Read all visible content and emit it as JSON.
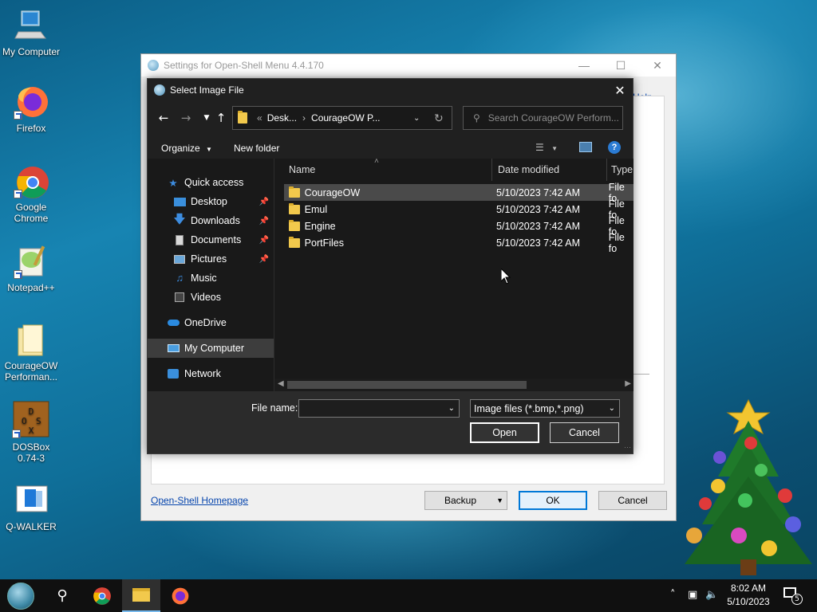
{
  "desktop": {
    "icons": [
      {
        "label": "My Computer"
      },
      {
        "label": "Firefox"
      },
      {
        "label": "Google Chrome"
      },
      {
        "label": "Notepad++"
      },
      {
        "label": "CourageOW Performan..."
      },
      {
        "label": "DOSBox 0.74-3"
      },
      {
        "label": "Q-WALKER"
      }
    ]
  },
  "settings_window": {
    "title": "Settings for Open-Shell Menu 4.4.170",
    "help_link": "Help...",
    "homepage_link": "Open-Shell Homepage",
    "backup_label": "Backup",
    "ok_label": "OK",
    "cancel_label": "Cancel"
  },
  "dialog": {
    "title": "Select Image File",
    "address": {
      "prefix": "«",
      "segment1": "Desk...",
      "segment2": "CourageOW P..."
    },
    "search_placeholder": "Search CourageOW Perform...",
    "organize_label": "Organize",
    "new_folder_label": "New folder",
    "nav_items": [
      {
        "label": "Quick access",
        "icon": "star-icon"
      },
      {
        "label": "Desktop",
        "icon": "desktop-icon",
        "pinned": true
      },
      {
        "label": "Downloads",
        "icon": "download-icon",
        "pinned": true
      },
      {
        "label": "Documents",
        "icon": "document-icon",
        "pinned": true
      },
      {
        "label": "Pictures",
        "icon": "pictures-icon",
        "pinned": true
      },
      {
        "label": "Music",
        "icon": "music-icon"
      },
      {
        "label": "Videos",
        "icon": "video-icon"
      },
      {
        "label": "OneDrive",
        "icon": "cloud-icon"
      },
      {
        "label": "My Computer",
        "icon": "computer-icon",
        "selected": true
      },
      {
        "label": "Network",
        "icon": "network-icon"
      }
    ],
    "columns": {
      "name": "Name",
      "date": "Date modified",
      "type": "Type"
    },
    "files": [
      {
        "name": "CourageOW",
        "date": "5/10/2023 7:42 AM",
        "type": "File fo"
      },
      {
        "name": "Emul",
        "date": "5/10/2023 7:42 AM",
        "type": "File fo"
      },
      {
        "name": "Engine",
        "date": "5/10/2023 7:42 AM",
        "type": "File fo"
      },
      {
        "name": "PortFiles",
        "date": "5/10/2023 7:42 AM",
        "type": "File fo"
      }
    ],
    "filename_label": "File name:",
    "filename_value": "",
    "filter_value": "Image files (*.bmp,*.png)",
    "open_label": "Open",
    "cancel_label": "Cancel"
  },
  "taskbar": {
    "time": "8:02 AM",
    "date": "5/10/2023",
    "notification_count": "5"
  }
}
